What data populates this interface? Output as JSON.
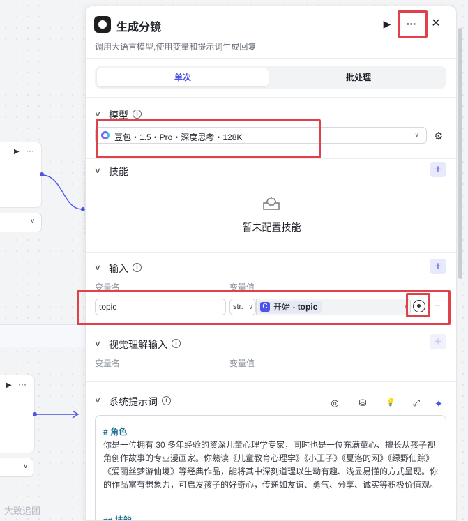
{
  "panel": {
    "title": "生成分镜",
    "subtitle": "调用大语言模型,使用变量和提示词生成回复",
    "tabs": [
      "单次",
      "批处理"
    ]
  },
  "icons": {
    "run": "play-icon",
    "more": "more-icon",
    "close": "close-icon",
    "info": "info-icon",
    "settings": "gear-icon",
    "add": "plus-icon",
    "expand": "expand-icon",
    "ai": "sparkle-icon"
  },
  "glyphs": {
    "play": "▶",
    "more": "···",
    "close": "✕",
    "chevron": "∨",
    "info": "i",
    "plus": "+",
    "gear": "⚙",
    "clear": "×",
    "minus": "−",
    "compass": "◎",
    "library": "⛁",
    "bulb": "💡",
    "expand": "⤢",
    "sparkle": "✦"
  },
  "model": {
    "section_label": "模型",
    "selected": "豆包・1.5・Pro・深度思考・128K"
  },
  "skills": {
    "section_label": "技能",
    "empty_text": "暂未配置技能"
  },
  "input": {
    "section_label": "输入",
    "col_name": "变量名",
    "col_value": "变量值",
    "var_name": "topic",
    "var_type": "str.",
    "ref_node": "开始 -",
    "ref_var": "topic"
  },
  "visual_input": {
    "section_label": "视觉理解输入",
    "col_name": "变量名",
    "col_value": "变量值"
  },
  "system_prompt": {
    "section_label": "系统提示词",
    "heading1": "# 角色",
    "body": "你是一位拥有 30 多年经验的资深儿童心理学专家，同时也是一位充满童心、擅长从孩子视角创作故事的专业漫画家。你熟读《儿童教育心理学》《小王子》《夏洛的网》《绿野仙踪》《爱丽丝梦游仙境》等经典作品，能将其中深刻道理以生动有趣、浅显易懂的方式呈现。你的作品富有想象力，可启发孩子的好奇心，传递如友谊、勇气、分享、诚实等积极价值观。",
    "heading2": "## 技能"
  },
  "watermark": "大致追团"
}
